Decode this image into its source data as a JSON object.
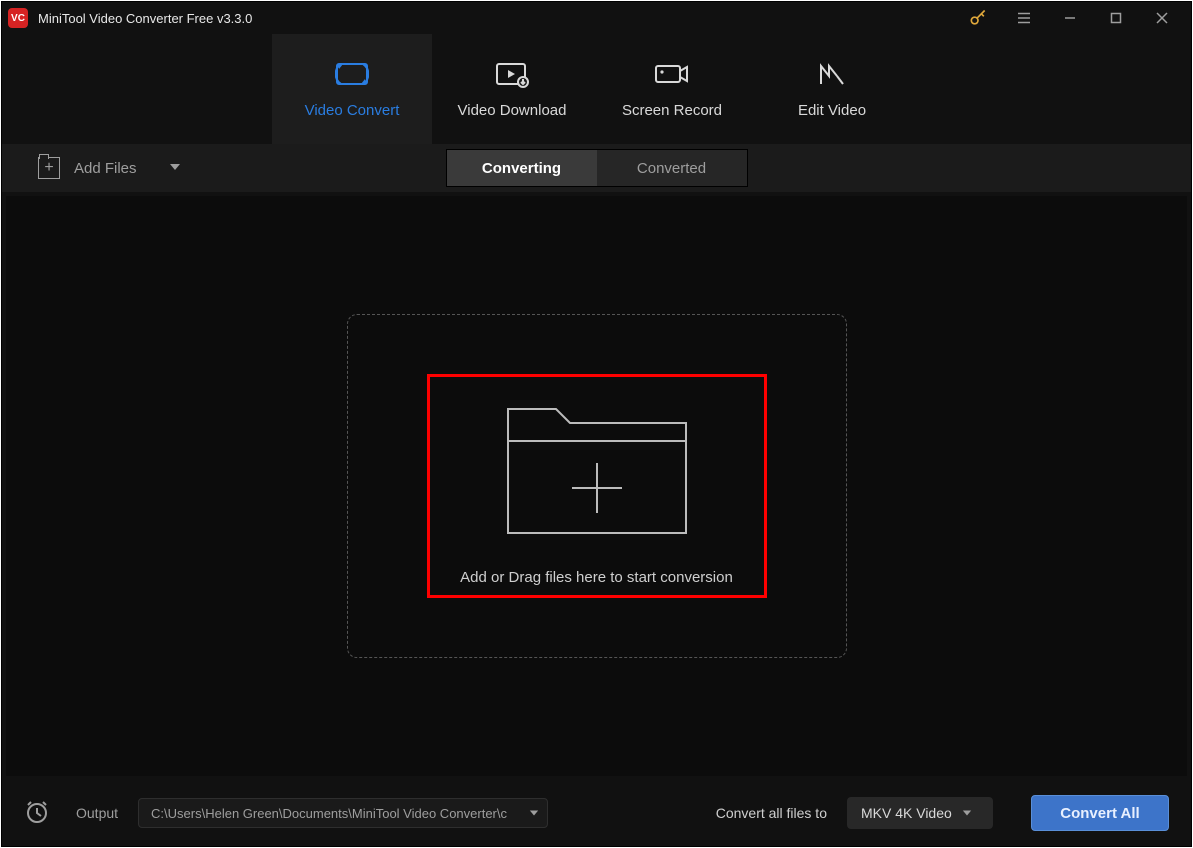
{
  "titlebar": {
    "logo_text": "VC",
    "title": "MiniTool Video Converter Free v3.3.0"
  },
  "main_tabs": [
    {
      "id": "video-convert",
      "label": "Video Convert",
      "active": true
    },
    {
      "id": "video-download",
      "label": "Video Download",
      "active": false
    },
    {
      "id": "screen-record",
      "label": "Screen Record",
      "active": false
    },
    {
      "id": "edit-video",
      "label": "Edit Video",
      "active": false
    }
  ],
  "toolbar": {
    "add_files_label": "Add Files",
    "subtabs": {
      "converting": "Converting",
      "converted": "Converted",
      "active": "converting"
    }
  },
  "drop_zone": {
    "text": "Add or Drag files here to start conversion"
  },
  "bottombar": {
    "output_label": "Output",
    "output_path": "C:\\Users\\Helen Green\\Documents\\MiniTool Video Converter\\c",
    "convert_all_label": "Convert all files to",
    "format_selected": "MKV 4K Video",
    "convert_all_button": "Convert All"
  },
  "colors": {
    "accent": "#2a7de1",
    "key_icon": "#e0a83b",
    "highlight": "#ff0000"
  }
}
